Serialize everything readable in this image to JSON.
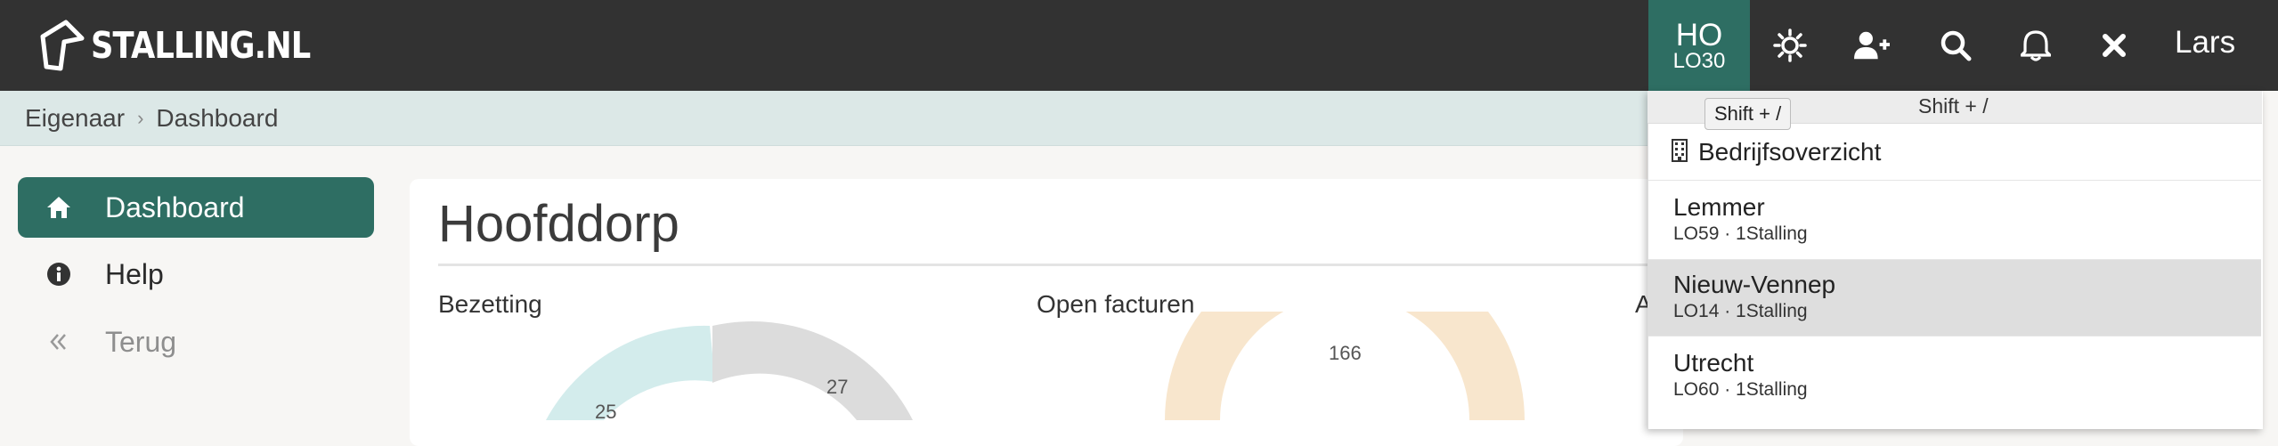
{
  "brand": {
    "logo_text": "STALLING.NL"
  },
  "header": {
    "location_code": "HO",
    "location_sub": "LO30",
    "icons": [
      "sun-icon",
      "add-user-icon",
      "search-icon",
      "bell-icon",
      "close-icon"
    ],
    "user_name": "Lars"
  },
  "breadcrumb": {
    "items": [
      "Eigenaar",
      "Dashboard"
    ]
  },
  "sidebar": {
    "items": [
      {
        "label": "Dashboard",
        "icon": "home-icon",
        "active": true
      },
      {
        "label": "Help",
        "icon": "info-icon",
        "active": false
      },
      {
        "label": "Terug",
        "icon": "double-chevron-left-icon",
        "active": false
      }
    ]
  },
  "main": {
    "title": "Hoofddorp",
    "sections": [
      {
        "label": "Bezetting"
      },
      {
        "label": "Open facturen"
      },
      {
        "label": "A"
      }
    ]
  },
  "donuts": {
    "bezetting": {
      "values": [
        25,
        27
      ],
      "colors": [
        "#d3ecec",
        "#dcdcdc"
      ]
    },
    "open_facturen": {
      "values": [
        166
      ],
      "colors": [
        "#f8e6cd"
      ]
    }
  },
  "dropdown": {
    "shortcut_hint": "Shift + /",
    "tooltip": "Shift + /",
    "overview_label": "Bedrijfsoverzicht",
    "locations": [
      {
        "name": "Lemmer",
        "sub": "LO59 · 1Stalling",
        "selected": false
      },
      {
        "name": "Nieuw-Vennep",
        "sub": "LO14 · 1Stalling",
        "selected": true
      },
      {
        "name": "Utrecht",
        "sub": "LO60 · 1Stalling",
        "selected": false
      }
    ]
  },
  "colors": {
    "topbar": "#323232",
    "accent": "#2e6e63",
    "breadcrumb_bg": "#dce8e7"
  }
}
